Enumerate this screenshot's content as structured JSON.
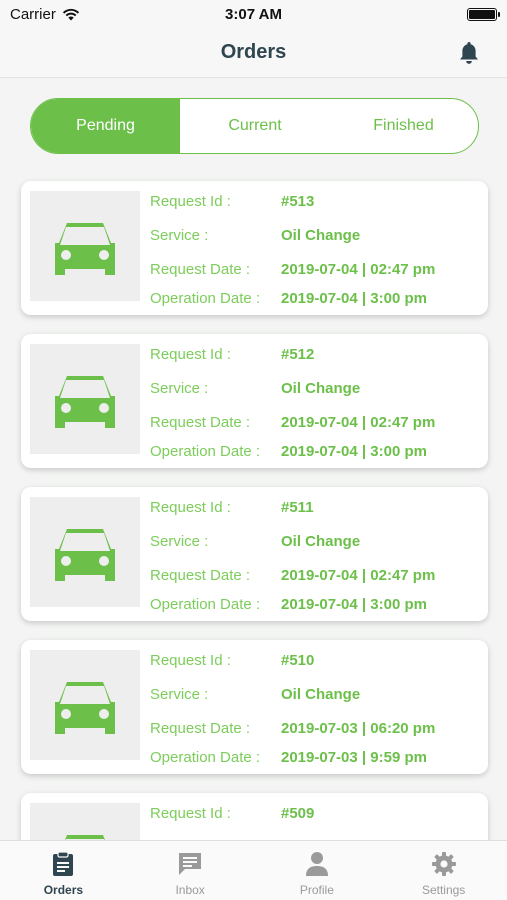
{
  "status": {
    "carrier": "Carrier",
    "time": "3:07 AM"
  },
  "nav": {
    "title": "Orders"
  },
  "segments": [
    {
      "label": "Pending",
      "active": true
    },
    {
      "label": "Current",
      "active": false
    },
    {
      "label": "Finished",
      "active": false
    }
  ],
  "labels": {
    "request_id": "Request Id :",
    "service": "Service :",
    "request_date": "Request Date :",
    "operation_date": "Operation Date :"
  },
  "orders": [
    {
      "id": "#513",
      "service": "Oil Change",
      "request_date": "2019-07-04 | 02:47 pm",
      "operation_date": "2019-07-04 | 3:00 pm"
    },
    {
      "id": "#512",
      "service": "Oil Change",
      "request_date": "2019-07-04 | 02:47 pm",
      "operation_date": "2019-07-04 | 3:00 pm"
    },
    {
      "id": "#511",
      "service": "Oil Change",
      "request_date": "2019-07-04 | 02:47 pm",
      "operation_date": "2019-07-04 | 3:00 pm"
    },
    {
      "id": "#510",
      "service": "Oil Change",
      "request_date": "2019-07-03 | 06:20 pm",
      "operation_date": "2019-07-03 | 9:59 pm"
    },
    {
      "id": "#509",
      "service": "",
      "request_date": "",
      "operation_date": ""
    }
  ],
  "tabs": [
    {
      "label": "Orders",
      "icon": "clipboard-icon",
      "active": true
    },
    {
      "label": "Inbox",
      "icon": "chat-icon",
      "active": false
    },
    {
      "label": "Profile",
      "icon": "person-icon",
      "active": false
    },
    {
      "label": "Settings",
      "icon": "gear-icon",
      "active": false
    }
  ],
  "colors": {
    "accent": "#6cc04a",
    "title": "#2f4550",
    "inactive_tab": "#9a9a9a"
  }
}
